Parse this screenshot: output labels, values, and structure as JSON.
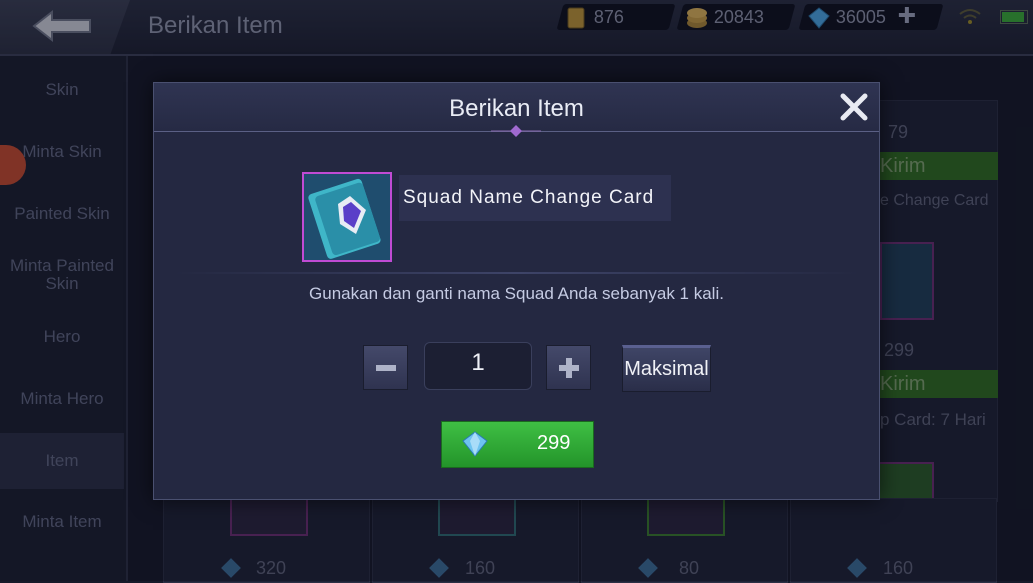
{
  "app": {
    "title": "Berikan Item"
  },
  "resources": {
    "ticket": "876",
    "gold": "20843",
    "diamond": "36005"
  },
  "sidebar": {
    "items": [
      {
        "label": "Skin"
      },
      {
        "label": "Minta Skin"
      },
      {
        "label": "Painted Skin"
      },
      {
        "label": "Minta Painted Skin"
      },
      {
        "label": "Hero"
      },
      {
        "label": "Minta Hero"
      },
      {
        "label": "Item"
      },
      {
        "label": "Minta Item"
      }
    ],
    "active_index": 6
  },
  "background": {
    "right_column": {
      "price1": "79",
      "send1": "Kirim",
      "name1": "e Change Card",
      "price2": "299",
      "send2": "Kirim",
      "name2": "p Card: 7 Hari"
    },
    "bottom_prices": [
      "320",
      "160",
      "80",
      "160"
    ]
  },
  "dialog": {
    "title": "Berikan Item",
    "item_name": "Squad Name Change Card",
    "description": "Gunakan dan ganti nama Squad Anda sebanyak 1 kali.",
    "quantity": "1",
    "max_label": "Maksimal",
    "price": "299"
  },
  "colors": {
    "accent_green": "#2fa835",
    "item_border": "#c04bd4",
    "diamond": "#4aa3e0"
  },
  "icons": [
    "back-arrow-icon",
    "ticket-icon",
    "gold-coin-icon",
    "diamond-icon",
    "plus-icon",
    "wifi-icon",
    "battery-icon",
    "close-icon",
    "minus-icon"
  ]
}
